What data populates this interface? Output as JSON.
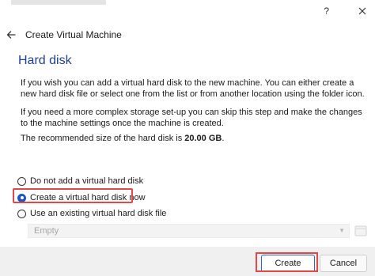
{
  "window": {
    "help_glyph": "?",
    "close_icon": "close-icon"
  },
  "header": {
    "title": "Create Virtual Machine",
    "back_icon": "arrow-left-icon"
  },
  "page": {
    "title": "Hard disk",
    "paragraph_1": "If you wish you can add a virtual hard disk to the new machine. You can either create a new hard disk file or select one from the list or from another location using the folder icon.",
    "paragraph_2": "If you need a more complex storage set-up you can skip this step and make the changes to the machine settings once the machine is created.",
    "recommended_prefix": "The recommended size of the hard disk is ",
    "recommended_size": "20.00 GB",
    "recommended_suffix": "."
  },
  "options": [
    {
      "label": "Do not add a virtual hard disk",
      "selected": false
    },
    {
      "label": "Create a virtual hard disk now",
      "selected": true
    },
    {
      "label": "Use an existing virtual hard disk file",
      "selected": false
    }
  ],
  "existing_disk": {
    "value": "Empty",
    "enabled": false,
    "folder_icon": "folder-icon"
  },
  "footer": {
    "create_label": "Create",
    "cancel_label": "Cancel"
  },
  "colors": {
    "accent": "#1a56c4",
    "title": "#1f3f8f",
    "highlight": "#e0484a"
  }
}
